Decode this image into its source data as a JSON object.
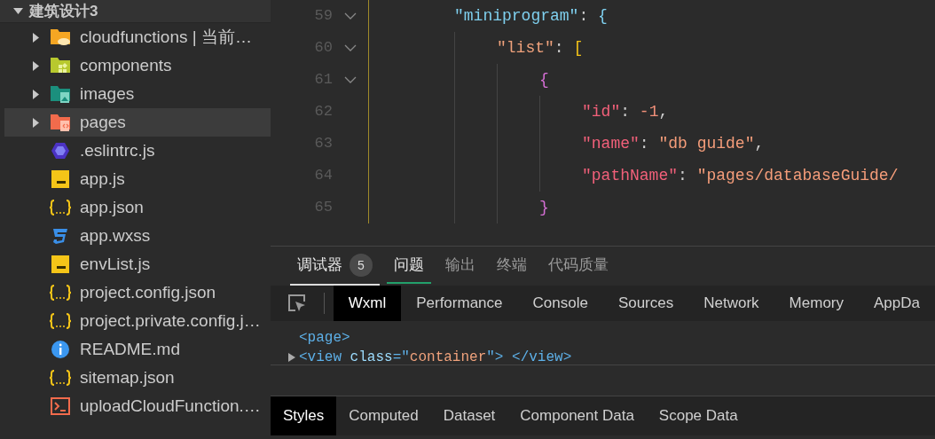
{
  "explorer": {
    "project": "建筑设计3",
    "expanded": true,
    "items": [
      {
        "name": "cloudfunctions | 当前…",
        "kind": "cloudfolder",
        "expanded": false,
        "selected": false
      },
      {
        "name": "components",
        "kind": "componentsfolder",
        "expanded": false,
        "selected": false
      },
      {
        "name": "images",
        "kind": "imagesfolder",
        "expanded": false,
        "selected": false
      },
      {
        "name": "pages",
        "kind": "pagesfolder",
        "expanded": false,
        "selected": true
      },
      {
        "name": ".eslintrc.js",
        "kind": "eslint",
        "selected": false
      },
      {
        "name": "app.js",
        "kind": "js",
        "selected": false
      },
      {
        "name": "app.json",
        "kind": "json",
        "selected": false
      },
      {
        "name": "app.wxss",
        "kind": "css",
        "selected": false
      },
      {
        "name": "envList.js",
        "kind": "js",
        "selected": false
      },
      {
        "name": "project.config.json",
        "kind": "json",
        "selected": false
      },
      {
        "name": "project.private.config.j…",
        "kind": "json",
        "selected": false
      },
      {
        "name": "README.md",
        "kind": "info",
        "selected": false
      },
      {
        "name": "sitemap.json",
        "kind": "json",
        "selected": false
      },
      {
        "name": "uploadCloudFunction.…",
        "kind": "script",
        "selected": false
      }
    ]
  },
  "editor": {
    "lines": [
      {
        "number": "59",
        "fold": true,
        "tokens": [
          {
            "text": "\"miniprogram\"",
            "color": "#7fd0ef"
          },
          {
            "text": ": ",
            "color": "#cccccc"
          },
          {
            "text": "{",
            "color": "#7fd0ef"
          }
        ],
        "children": [
          {
            "number": "60",
            "fold": true,
            "tokens": [
              {
                "text": "\"list\"",
                "color": "#f0a27c"
              },
              {
                "text": ": ",
                "color": "#cccccc"
              },
              {
                "text": "[",
                "color": "#f5c518"
              }
            ],
            "children": [
              {
                "number": "61",
                "fold": true,
                "tokens": [
                  {
                    "text": "{",
                    "color": "#d66fd6"
                  }
                ],
                "children": [
                  {
                    "number": "62",
                    "fold": false,
                    "tokens": [
                      {
                        "text": "\"id\"",
                        "color": "#f2607a"
                      },
                      {
                        "text": ": ",
                        "color": "#cccccc"
                      },
                      {
                        "text": "-1",
                        "color": "#f2907a"
                      },
                      {
                        "text": ",",
                        "color": "#cccccc"
                      }
                    ]
                  },
                  {
                    "number": "63",
                    "fold": false,
                    "tokens": [
                      {
                        "text": "\"name\"",
                        "color": "#f2607a"
                      },
                      {
                        "text": ": ",
                        "color": "#cccccc"
                      },
                      {
                        "text": "\"db guide\"",
                        "color": "#f59d7a"
                      },
                      {
                        "text": ",",
                        "color": "#cccccc"
                      }
                    ]
                  },
                  {
                    "number": "64",
                    "fold": false,
                    "tokens": [
                      {
                        "text": "\"pathName\"",
                        "color": "#f2607a"
                      },
                      {
                        "text": ": ",
                        "color": "#cccccc"
                      },
                      {
                        "text": "\"pages/databaseGuide/",
                        "color": "#f59d7a"
                      }
                    ]
                  }
                ]
              },
              {
                "number": "65",
                "fold": false,
                "tokens": [
                  {
                    "text": "}",
                    "color": "#d66fd6"
                  }
                ]
              }
            ]
          }
        ]
      }
    ]
  },
  "panel_tabs": [
    {
      "label": "调试器",
      "badge": "5",
      "selected": true,
      "active": false
    },
    {
      "label": "问题",
      "selected": false,
      "active": true
    },
    {
      "label": "输出",
      "selected": false,
      "active": false
    },
    {
      "label": "终端",
      "selected": false,
      "active": false
    },
    {
      "label": "代码质量",
      "selected": false,
      "active": false
    }
  ],
  "devtools_tabs": [
    {
      "label": "Wxml",
      "selected": true
    },
    {
      "label": "Performance",
      "selected": false
    },
    {
      "label": "Console",
      "selected": false
    },
    {
      "label": "Sources",
      "selected": false
    },
    {
      "label": "Network",
      "selected": false
    },
    {
      "label": "Memory",
      "selected": false
    },
    {
      "label": "AppDa",
      "selected": false
    }
  ],
  "wxml": [
    {
      "expandable": false,
      "tokens": [
        {
          "text": "<page>",
          "color": "#5db0e8"
        }
      ]
    },
    {
      "expandable": true,
      "tokens": [
        {
          "text": "<view ",
          "color": "#5db0e8"
        },
        {
          "text": "class",
          "color": "#9cdcfe"
        },
        {
          "text": "=\"",
          "color": "#5db0e8"
        },
        {
          "text": "container",
          "color": "#f0a27c"
        },
        {
          "text": "\"> </view>",
          "color": "#5db0e8"
        }
      ]
    }
  ],
  "style_tabs": [
    {
      "label": "Styles",
      "selected": true
    },
    {
      "label": "Computed",
      "selected": false
    },
    {
      "label": "Dataset",
      "selected": false
    },
    {
      "label": "Component Data",
      "selected": false
    },
    {
      "label": "Scope Data",
      "selected": false
    }
  ]
}
